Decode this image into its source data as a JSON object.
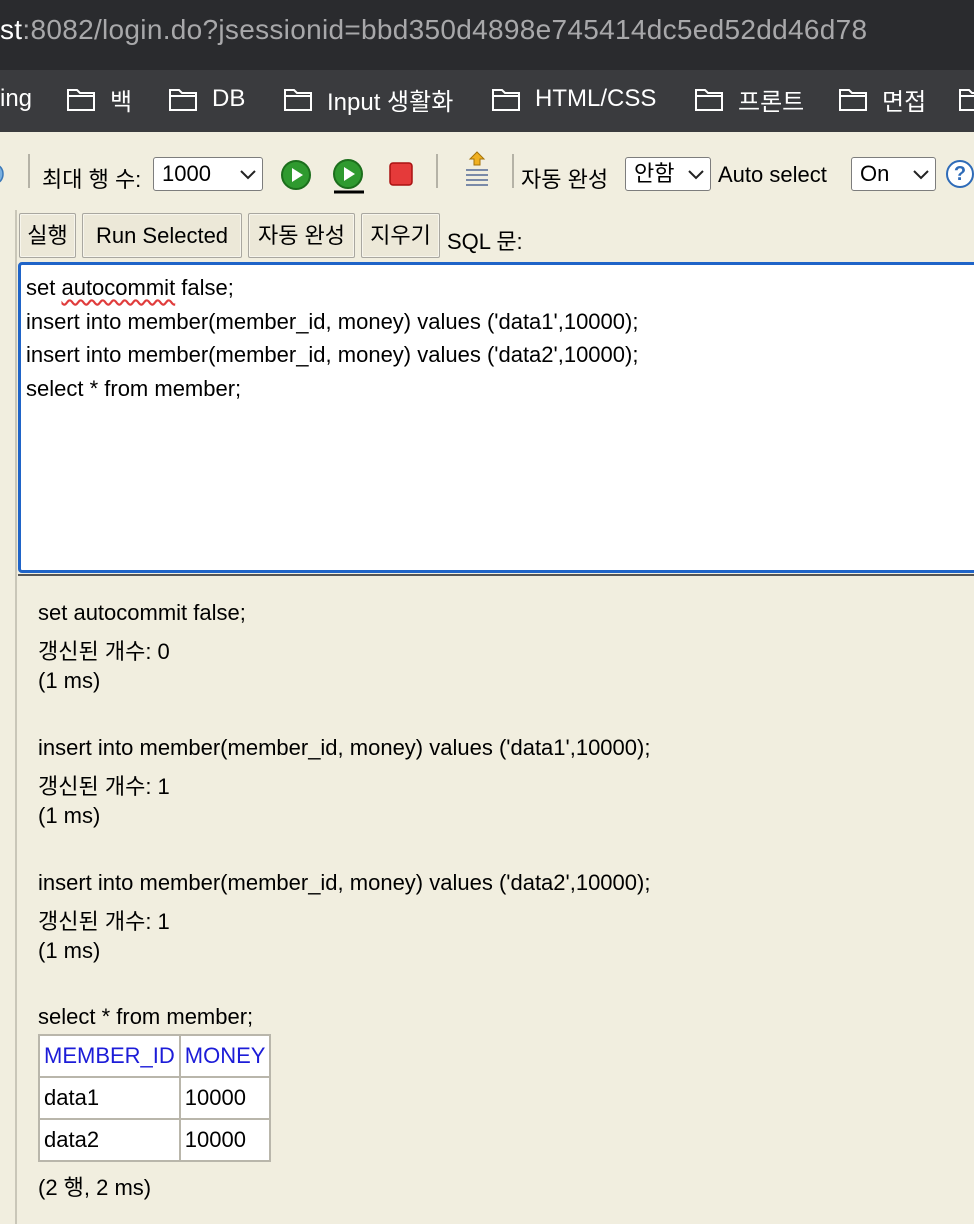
{
  "browser": {
    "url_host": "st",
    "url_rest": ":8082/login.do?jsessionid=bbd350d4898e745414dc5ed52dd46d78",
    "bookmarks": [
      {
        "label": "ing",
        "icon": "none"
      },
      {
        "label": "백",
        "icon": "folder-icon"
      },
      {
        "label": "DB",
        "icon": "folder-icon"
      },
      {
        "label": "Input 생활화",
        "icon": "folder-icon"
      },
      {
        "label": "HTML/CSS",
        "icon": "folder-icon"
      },
      {
        "label": "프론트",
        "icon": "folder-icon"
      },
      {
        "label": "면접",
        "icon": "folder-icon"
      }
    ]
  },
  "toolbar": {
    "max_rows_label": "최대 행 수:",
    "max_rows_value": "1000",
    "autocomplete_label": "자동 완성",
    "autocomplete_value": "안함",
    "auto_select_label": "Auto select",
    "auto_select_value": "On",
    "help": "?"
  },
  "buttons": {
    "run": "실행",
    "run_selected": "Run Selected",
    "autocomplete": "자동 완성",
    "clear": "지우기",
    "sql_label": "SQL 문:"
  },
  "editor": {
    "lines": [
      "set autocommit false;",
      "insert into member(member_id, money) values ('data1',10000);",
      "insert into member(member_id, money) values ('data2',10000);",
      "select * from member;"
    ],
    "line1_pre": "set ",
    "line1_squiggle": "autocommit",
    "line1_post": " false;"
  },
  "results": {
    "blocks": [
      {
        "sql": "set autocommit false;",
        "updated": "갱신된 개수: 0",
        "time": "(1 ms)"
      },
      {
        "sql": "insert into member(member_id, money) values ('data1',10000);",
        "updated": "갱신된 개수: 1",
        "time": "(1 ms)"
      },
      {
        "sql": "insert into member(member_id, money) values ('data2',10000);",
        "updated": "갱신된 개수: 1",
        "time": "(1 ms)"
      }
    ],
    "select_sql": "select * from member;",
    "table": {
      "columns": [
        "MEMBER_ID",
        "MONEY"
      ],
      "rows": [
        [
          "data1",
          "10000"
        ],
        [
          "data2",
          "10000"
        ]
      ]
    },
    "summary": "(2 행, 2 ms)"
  },
  "colors": {
    "accent": "#1f64c8",
    "background": "#f1eedf",
    "header_text": "#1c1cd8"
  }
}
